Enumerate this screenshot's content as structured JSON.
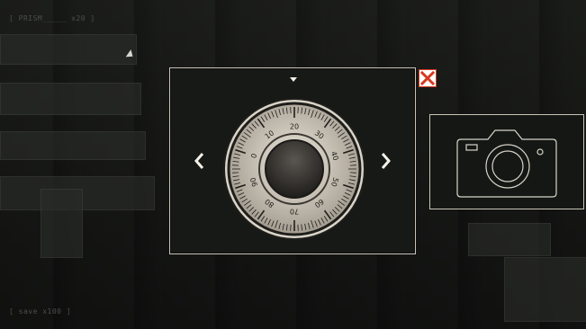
{
  "hud": {
    "top_label": "[ PRISM_____ x20 ]",
    "bottom_label": "[ save x100 ]"
  },
  "dial": {
    "numbers": [
      "0",
      "10",
      "20",
      "30",
      "40",
      "50",
      "60",
      "70",
      "80",
      "90"
    ],
    "current_value": 20
  },
  "icons": {
    "left": "chevron-left-icon",
    "right": "chevron-right-icon",
    "close": "close-icon",
    "camera": "camera-icon",
    "marker": "dial-marker-icon"
  },
  "colors": {
    "frame": "#c9c4b7",
    "dialog_bg": "#171916",
    "close_red": "#d33b1f",
    "dial_metal": "#b8b1a4"
  }
}
